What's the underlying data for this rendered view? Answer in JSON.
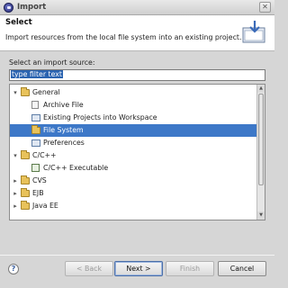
{
  "window": {
    "title": "Import",
    "close_glyph": "✕"
  },
  "header": {
    "title": "Select",
    "description": "Import resources from the local file system into an existing project."
  },
  "source": {
    "label": "Select an import source:",
    "filter_value": "type filter text"
  },
  "tree": [
    {
      "label": "General",
      "expanded": true,
      "icon": "folder-icon"
    },
    {
      "label": "Archive File",
      "icon": "archive-file-icon"
    },
    {
      "label": "Existing Projects into Workspace",
      "icon": "projects-icon"
    },
    {
      "label": "File System",
      "icon": "folder-icon",
      "selected": true
    },
    {
      "label": "Preferences",
      "icon": "preferences-icon"
    },
    {
      "label": "C/C++",
      "expanded": true,
      "icon": "folder-icon"
    },
    {
      "label": "C/C++ Executable",
      "icon": "c-executable-icon"
    },
    {
      "label": "CVS",
      "expanded": false,
      "icon": "folder-icon"
    },
    {
      "label": "EJB",
      "expanded": false,
      "icon": "folder-icon"
    },
    {
      "label": "Java EE",
      "expanded": false,
      "icon": "folder-icon"
    }
  ],
  "buttons": {
    "help": "?",
    "back": "< Back",
    "next": "Next >",
    "finish": "Finish",
    "cancel": "Cancel"
  },
  "colors": {
    "selection": "#3d78c8",
    "filter_highlight": "#2a63b0"
  }
}
